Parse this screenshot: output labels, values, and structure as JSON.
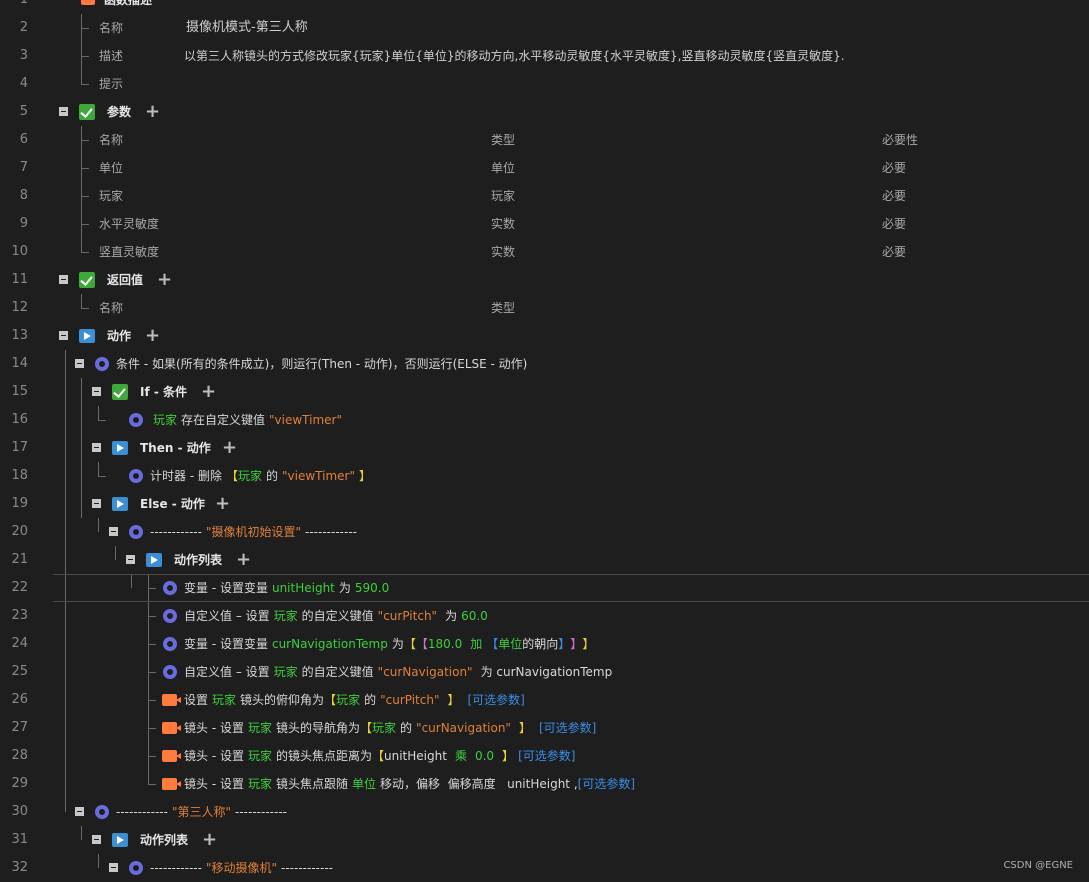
{
  "rows": {
    "r1": {
      "num": "1",
      "label": "函数描述"
    },
    "r2": {
      "num": "2",
      "label": "名称",
      "value": "摄像机模式-第三人称"
    },
    "r3": {
      "num": "3",
      "label": "描述",
      "value": "以第三人称镜头的方式修改玩家{玩家}单位{单位}的移动方向,水平移动灵敏度{水平灵敏度},竖直移动灵敏度{竖直灵敏度}."
    },
    "r4": {
      "num": "4",
      "label": "提示"
    },
    "r5": {
      "num": "5",
      "label": "参数"
    },
    "r6": {
      "num": "6",
      "c1": "名称",
      "c2": "类型",
      "c3": "必要性"
    },
    "r7": {
      "num": "7",
      "c1": "单位",
      "c2": "单位",
      "c3": "必要"
    },
    "r8": {
      "num": "8",
      "c1": "玩家",
      "c2": "玩家",
      "c3": "必要"
    },
    "r9": {
      "num": "9",
      "c1": "水平灵敏度",
      "c2": "实数",
      "c3": "必要"
    },
    "r10": {
      "num": "10",
      "c1": "竖直灵敏度",
      "c2": "实数",
      "c3": "必要"
    },
    "r11": {
      "num": "11",
      "label": "返回值"
    },
    "r12": {
      "num": "12",
      "c1": "名称",
      "c2": "类型"
    },
    "r13": {
      "num": "13",
      "label": "动作"
    },
    "r14": {
      "num": "14",
      "text": "条件 - 如果(所有的条件成立)，则运行(Then - 动作)，否则运行(ELSE - 动作)"
    },
    "r15": {
      "num": "15",
      "label": "If - 条件"
    },
    "r16": {
      "num": "16",
      "t1": "玩家",
      "t2": "存在自定义键值",
      "t3": "\"viewTimer\""
    },
    "r17": {
      "num": "17",
      "label": "Then - 动作"
    },
    "r18": {
      "num": "18",
      "t1": "计时器 - 删除",
      "t2": "【",
      "t3": "玩家",
      "t4": "的",
      "t5": "\"viewTimer\"",
      "t6": "】"
    },
    "r19": {
      "num": "19",
      "label": "Else - 动作"
    },
    "r20": {
      "num": "20",
      "t1": "------------",
      "t2": "\"摄像机初始设置\"",
      "t3": "------------"
    },
    "r21": {
      "num": "21",
      "label": "动作列表"
    },
    "r22": {
      "num": "22",
      "t1": "变量 - 设置变量",
      "t2": "unitHeight",
      "t3": "为",
      "t4": "590.0"
    },
    "r23": {
      "num": "23",
      "t1": "自定义值 – 设置",
      "t2": "玩家",
      "t3": "的自定义键值",
      "t4": "\"curPitch\"",
      "t5": "为",
      "t6": "60.0"
    },
    "r24": {
      "num": "24",
      "t1": "变量 - 设置变量",
      "t2": "curNavigationTemp",
      "t3": "为",
      "t4": "【",
      "t5": "【",
      "t6": "180.0",
      "t7": "加",
      "t8": "【",
      "t9": "单位",
      "t10": "的朝向",
      "t11": "】",
      "t12": "】",
      "t13": "】"
    },
    "r25": {
      "num": "25",
      "t1": "自定义值 – 设置",
      "t2": "玩家",
      "t3": "的自定义键值",
      "t4": "\"curNavigation\"",
      "t5": "为 curNavigationTemp"
    },
    "r26": {
      "num": "26",
      "t1": "设置",
      "t2": "玩家",
      "t3": "镜头的俯仰角为",
      "t4": "【",
      "t5": "玩家",
      "t6": "的",
      "t7": "\"curPitch\"",
      "t8": "】",
      "t9": "[可选参数]"
    },
    "r27": {
      "num": "27",
      "t1": "镜头 - 设置",
      "t2": "玩家",
      "t3": "镜头的导航角为",
      "t4": "【",
      "t5": "玩家",
      "t6": "的",
      "t7": "\"curNavigation\"",
      "t8": "】",
      "t9": "[可选参数]"
    },
    "r28": {
      "num": "28",
      "t1": "镜头 - 设置",
      "t2": "玩家",
      "t3": "的镜头焦点距离为",
      "t4": "【",
      "t5": "unitHeight",
      "t6": "乘",
      "t7": "0.0",
      "t8": "】",
      "t9": "[可选参数]"
    },
    "r29": {
      "num": "29",
      "t1": "镜头 - 设置",
      "t2": "玩家",
      "t3": "镜头焦点跟随",
      "t4": "单位",
      "t5": "移动，偏移  偏移高度   unitHeight ,",
      "t6": "[可选参数]"
    },
    "r30": {
      "num": "30",
      "t1": "------------",
      "t2": "\"第三人称\"",
      "t3": "------------"
    },
    "r31": {
      "num": "31",
      "label": "动作列表"
    },
    "r32": {
      "num": "32",
      "t1": "------------",
      "t2": "\"移动摄像机\"",
      "t3": "------------"
    }
  },
  "watermark": "CSDN @EGNE",
  "colors": {
    "bg": "#1e1e1e",
    "green": "#3ecf3e",
    "orange": "#e0803a",
    "yellow": "#e8d23a",
    "pink": "#d070d0",
    "blue": "#3a8ee8"
  }
}
